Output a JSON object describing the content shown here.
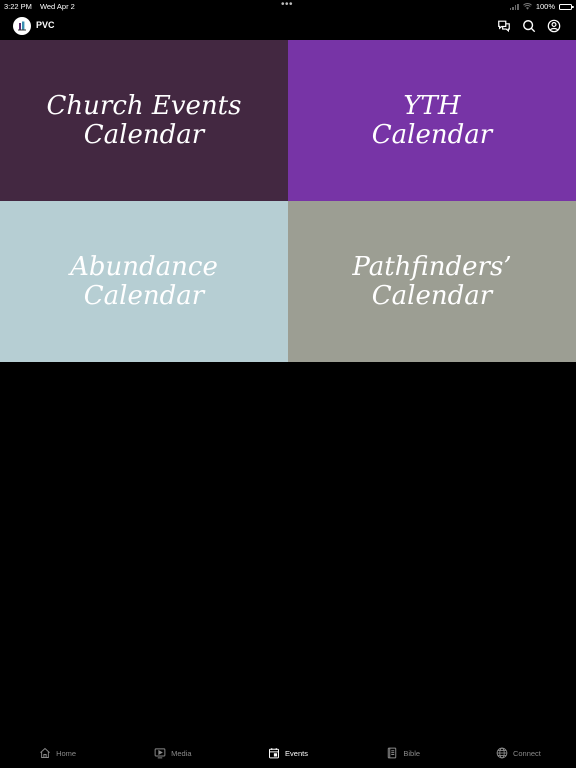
{
  "status_bar": {
    "time": "3:22 PM",
    "date": "Wed Apr 2",
    "dots": "•••",
    "battery": "100%"
  },
  "header": {
    "app_name": "PVC",
    "icons": [
      "chat-icon",
      "search-icon",
      "account-icon"
    ]
  },
  "tiles": [
    {
      "line1": "Church Events",
      "line2": "Calendar",
      "color": "#432841"
    },
    {
      "line1": "YTH",
      "line2": "Calendar",
      "color": "#7734a6"
    },
    {
      "line1": "Abundance",
      "line2": "Calendar",
      "color": "#b6ced3"
    },
    {
      "line1": "Pathfinders’",
      "line2": "Calendar",
      "color": "#9c9e93"
    }
  ],
  "tab_bar": {
    "active": "Events",
    "items": [
      {
        "label": "Home",
        "icon": "home-icon"
      },
      {
        "label": "Media",
        "icon": "media-icon"
      },
      {
        "label": "Events",
        "icon": "calendar-icon"
      },
      {
        "label": "Bible",
        "icon": "bible-icon"
      },
      {
        "label": "Connect",
        "icon": "globe-icon"
      }
    ]
  }
}
